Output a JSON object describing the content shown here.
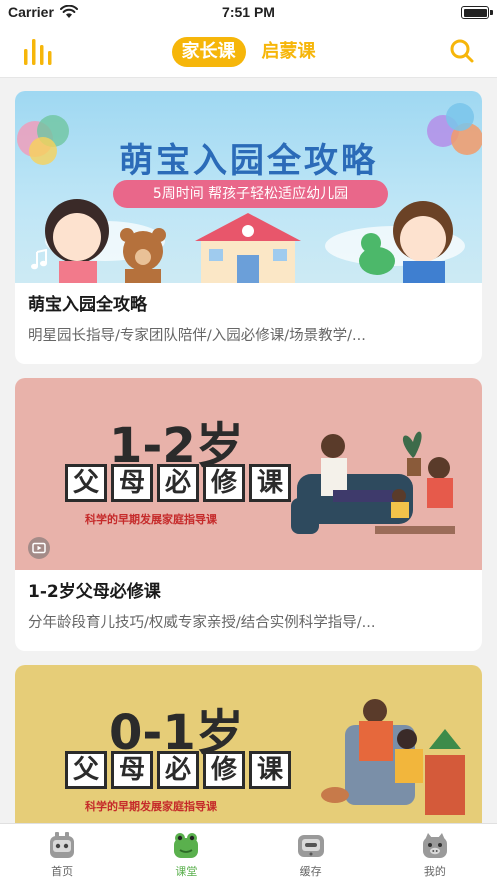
{
  "status_bar": {
    "carrier": "Carrier",
    "time": "7:51 PM"
  },
  "nav": {
    "tabs": [
      {
        "label": "家长课",
        "active": true
      },
      {
        "label": "启蒙课",
        "active": false
      }
    ],
    "accent_color": "#f6b60a"
  },
  "cards": [
    {
      "banner": {
        "title": "萌宝入园全攻略",
        "pill": "5周时间 帮孩子轻松适应幼儿园",
        "badge_icon": "music-note-icon"
      },
      "title": "萌宝入园全攻略",
      "desc": "明星园长指导/专家团队陪伴/入园必修课/场景教学/..."
    },
    {
      "banner": {
        "age": "1-2岁",
        "course_chars": [
          "父",
          "母",
          "必",
          "修",
          "课"
        ],
        "subtitle": "科学的早期发展家庭指导课",
        "badge_icon": "video-icon"
      },
      "title": "1-2岁父母必修课",
      "desc": "分年龄段育儿技巧/权威专家亲授/结合实例科学指导/..."
    },
    {
      "banner": {
        "age": "0-1岁",
        "course_chars": [
          "父",
          "母",
          "必",
          "修",
          "课"
        ],
        "subtitle": "科学的早期发展家庭指导课"
      }
    }
  ],
  "tab_bar": {
    "items": [
      {
        "label": "首页",
        "icon": "home-robot-icon",
        "active": false
      },
      {
        "label": "课堂",
        "icon": "classroom-frog-icon",
        "active": true
      },
      {
        "label": "缓存",
        "icon": "cache-tv-icon",
        "active": false
      },
      {
        "label": "我的",
        "icon": "profile-pig-icon",
        "active": false
      }
    ],
    "active_color": "#5ab04d"
  }
}
